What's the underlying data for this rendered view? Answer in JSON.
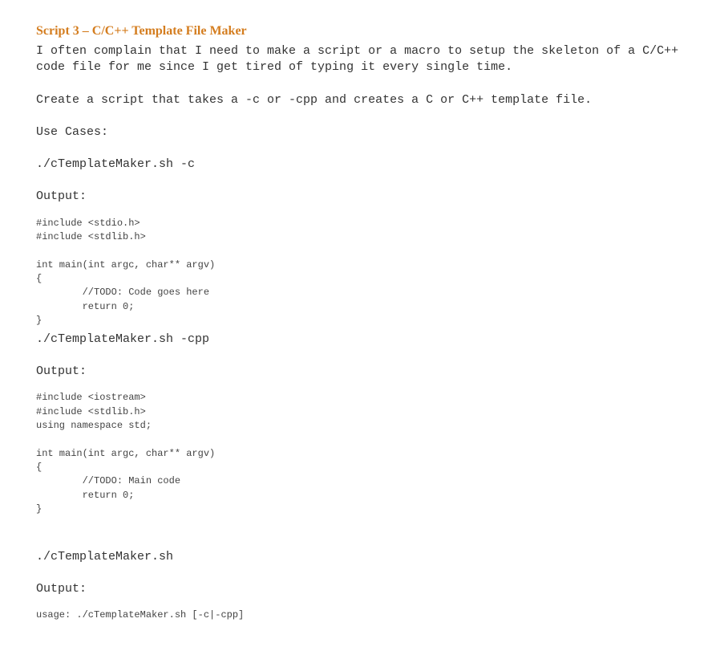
{
  "heading": "Script 3 – C/C++ Template File Maker",
  "intro": "I often complain that I need to make a script or a macro to setup the skeleton of a C/C++ code file for me since I get tired of typing it every single time.",
  "task": "Create a script that takes a -c or -cpp and creates a C or C++ template file.",
  "usecases_label": "Use Cases:",
  "example1": {
    "cmd": "./cTemplateMaker.sh -c",
    "output_label": "Output:",
    "code": "#include <stdio.h>\n#include <stdlib.h>\n\nint main(int argc, char** argv)\n{\n        //TODO: Code goes here\n        return 0;\n}"
  },
  "example2": {
    "cmd": "./cTemplateMaker.sh -cpp",
    "output_label": "Output:",
    "code": "#include <iostream>\n#include <stdlib.h>\nusing namespace std;\n\nint main(int argc, char** argv)\n{\n        //TODO: Main code\n        return 0;\n}"
  },
  "example3": {
    "cmd": "./cTemplateMaker.sh",
    "output_label": "Output:",
    "code": "usage: ./cTemplateMaker.sh [-c|-cpp]"
  }
}
